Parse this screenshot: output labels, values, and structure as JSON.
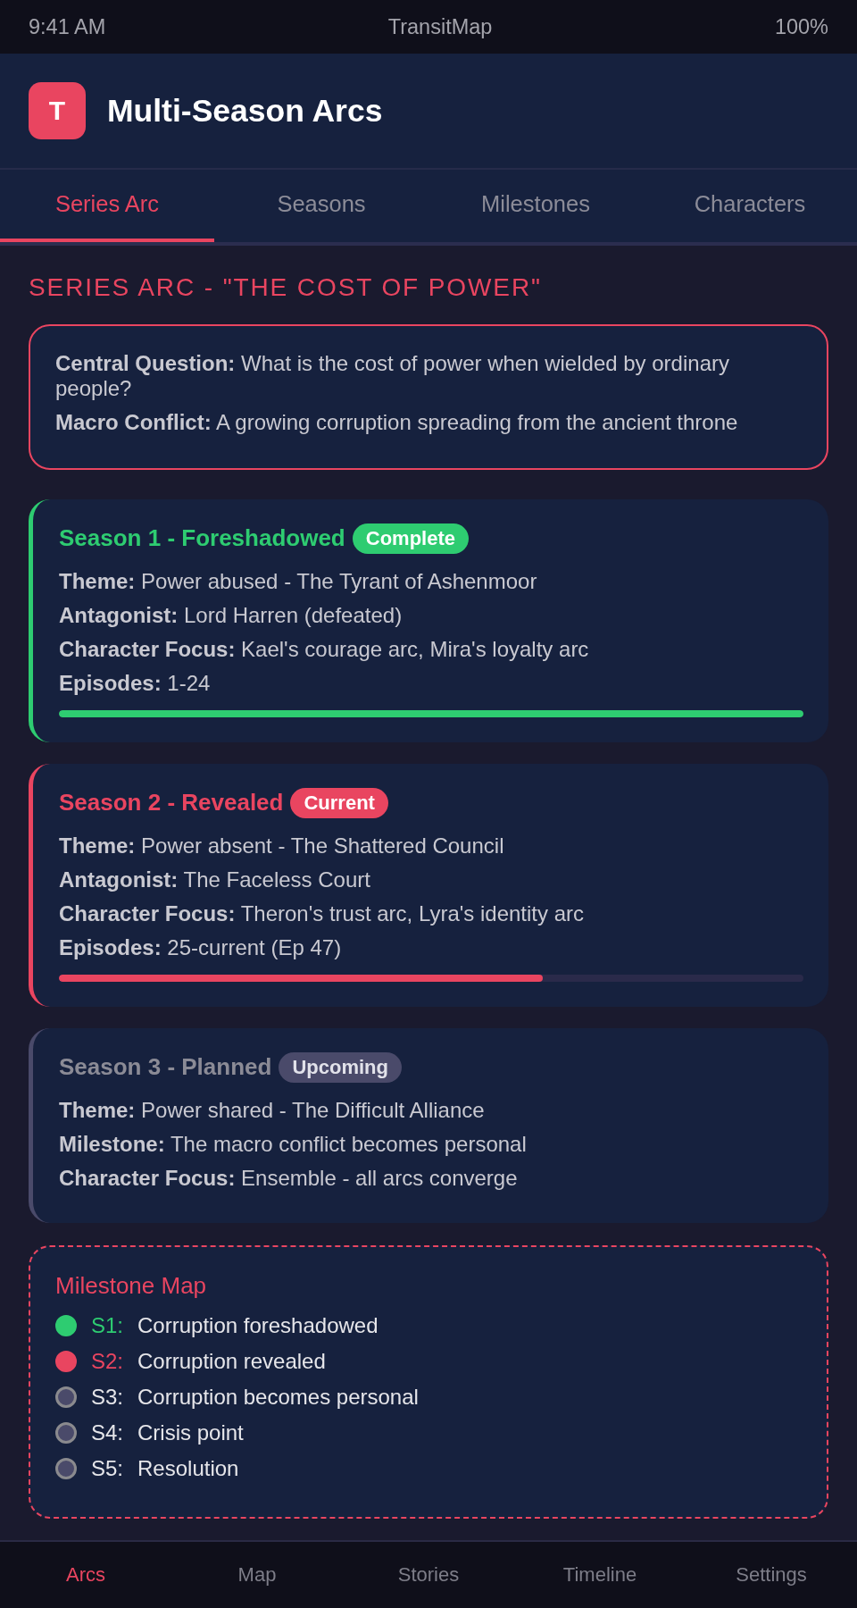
{
  "status_bar": {
    "time": "9:41 AM",
    "app": "TransitMap",
    "battery": "100%"
  },
  "header": {
    "logo": "T",
    "title": "Multi-Season Arcs"
  },
  "tabs": [
    {
      "label": "Series Arc",
      "selected": true
    },
    {
      "label": "Seasons",
      "selected": false
    },
    {
      "label": "Milestones",
      "selected": false
    },
    {
      "label": "Characters",
      "selected": false
    }
  ],
  "section_title": "SERIES ARC - \"THE COST OF POWER\"",
  "summary": [
    "**Central Question:** What is the cost of power when wielded by ordinary people?",
    "**Macro Conflict:** A growing corruption spreading from the ancient throne"
  ],
  "seasons": [
    {
      "title": "Season 1 - Foreshadowed",
      "kind": "complete",
      "badge": "Complete",
      "details": [
        "**Theme:** Power abused - The Tyrant of Ashenmoor",
        "**Antagonist:** Lord Harren (defeated)",
        "**Character Focus:** Kael's courage arc, Mira's loyalty arc",
        "**Episodes:** 1-24"
      ],
      "level": 1
    },
    {
      "title": "Season 2 - Revealed",
      "kind": "current",
      "badge": "Current",
      "details": [
        "**Theme:** Power absent - The Shattered Council",
        "**Antagonist:** The Faceless Court",
        "**Character Focus:** Theron's trust arc, Lyra's identity arc",
        "**Episodes:** 25-current (Ep 47)"
      ],
      "level": 0.65
    },
    {
      "title": "Season 3 - Planned",
      "kind": "upcoming",
      "badge": "Upcoming",
      "details": [
        "**Theme:** Power shared - The Difficult Alliance",
        "**Milestone:** The macro conflict becomes personal",
        "**Character Focus:** Ensemble - all arcs converge"
      ]
    }
  ],
  "milestone_map": {
    "title": "Milestone Map",
    "items": [
      {
        "code": "S1:",
        "text": "Corruption foreshadowed",
        "kind": "complete"
      },
      {
        "code": "S2:",
        "text": "Corruption revealed",
        "kind": "current"
      },
      {
        "code": "S3:",
        "text": "Corruption becomes personal",
        "kind": "upcoming"
      },
      {
        "code": "S4:",
        "text": "Crisis point",
        "kind": "upcoming"
      },
      {
        "code": "S5:",
        "text": "Resolution",
        "kind": "upcoming"
      }
    ]
  },
  "bottom_nav": [
    {
      "label": "Arcs",
      "selected": true
    },
    {
      "label": "Map",
      "selected": false
    },
    {
      "label": "Stories",
      "selected": false
    },
    {
      "label": "Timeline",
      "selected": false
    },
    {
      "label": "Settings",
      "selected": false
    }
  ]
}
